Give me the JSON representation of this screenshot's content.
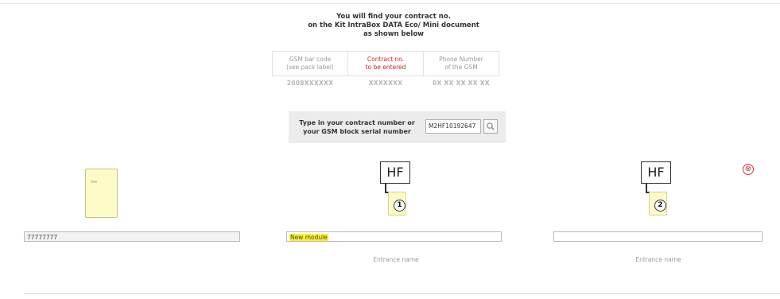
{
  "intro": {
    "line1": "You will find your contract no.",
    "line2": "on the Kit IntraBox DATA Eco/ Mini document",
    "line3": "as shown below"
  },
  "contract_table": {
    "headers": [
      {
        "line1": "GSM bar code",
        "line2": "(see pack label)"
      },
      {
        "line1": "Contract no.",
        "line2": "to be entered"
      },
      {
        "line1": "Phone Number",
        "line2": "of the GSM"
      }
    ],
    "values": [
      "2008XXXXXX",
      "XXXXXXX",
      "0X XX XX XX XX"
    ],
    "highlight_color": "#cc2222"
  },
  "search": {
    "label_line1": "Type in your contract number or",
    "label_line2": "your GSM block serial number",
    "value": "M2HF10192647",
    "button_icon": "search-icon"
  },
  "modules": [
    {
      "field_value": "77777777"
    },
    {
      "hf_label": "HF",
      "number": "1",
      "field_value": "New module",
      "field_label": "Entrance name"
    },
    {
      "hf_label": "HF",
      "number": "2",
      "field_value": "",
      "field_label": "Entrance name"
    }
  ],
  "close_icon": {
    "glyph": "⊗",
    "color": "#d23333"
  },
  "colors": {
    "device_fill": "#fcfbc7",
    "highlight": "#fff12b"
  }
}
